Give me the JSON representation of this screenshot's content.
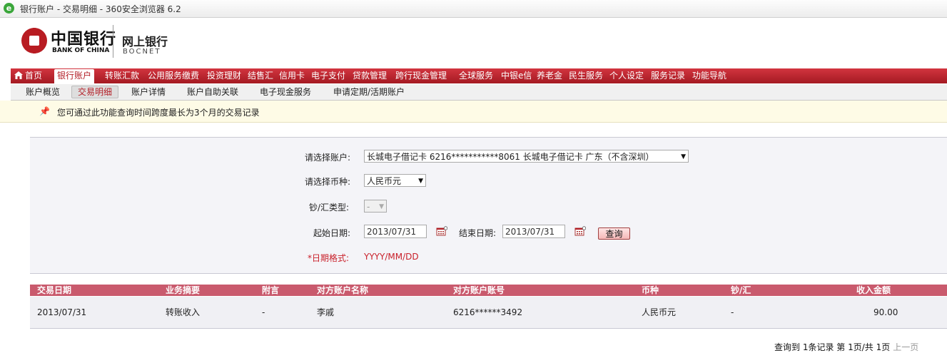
{
  "window": {
    "title": "银行账户 - 交易明细 - 360安全浏览器 6.2"
  },
  "brand": {
    "name_cn": "中国银行",
    "name_en": "BANK OF CHINA",
    "service_cn": "网上银行",
    "service_en": "BOCNET"
  },
  "main_nav": [
    "首页",
    "银行账户",
    "转账汇款",
    "公用服务缴费",
    "投资理财",
    "结售汇",
    "信用卡",
    "电子支付",
    "贷款管理",
    "跨行现金管理",
    "全球服务",
    "中银e信",
    "养老金",
    "民生服务",
    "个人设定",
    "服务记录",
    "功能导航"
  ],
  "sub_nav": [
    "账户概览",
    "交易明细",
    "账户详情",
    "账户自助关联",
    "电子现金服务",
    "申请定期/活期账户"
  ],
  "notice": "您可通过此功能查询时间跨度最长为3个月的交易记录",
  "form": {
    "account_label": "请选择账户:",
    "account_value": "长城电子借记卡 6216***********8061 长城电子借记卡 广东（不含深圳）",
    "currency_label": "请选择币种:",
    "currency_value": "人民币元",
    "cash_type_label": "钞/汇类型:",
    "cash_type_value": "-",
    "start_label": "起始日期:",
    "start_value": "2013/07/31",
    "end_label": "结束日期:",
    "end_value": "2013/07/31",
    "query_button": "查询",
    "hint_label": "*日期格式:",
    "hint_value": "YYYY/MM/DD"
  },
  "table": {
    "columns": [
      "交易日期",
      "业务摘要",
      "附言",
      "对方账户名称",
      "对方账户账号",
      "币种",
      "钞/汇",
      "收入金额"
    ],
    "rows": [
      [
        "2013/07/31",
        "转账收入",
        "-",
        "李戚",
        "6216******3492",
        "人民币元",
        "-",
        "90.00"
      ]
    ]
  },
  "pager": {
    "summary": "查询到 1条记录  第 1页/共 1页",
    "prev": "上一页"
  },
  "colors": {
    "brand_red": "#b31e26",
    "table_header": "#c95a6d",
    "notice_bg": "#fefbe6"
  }
}
